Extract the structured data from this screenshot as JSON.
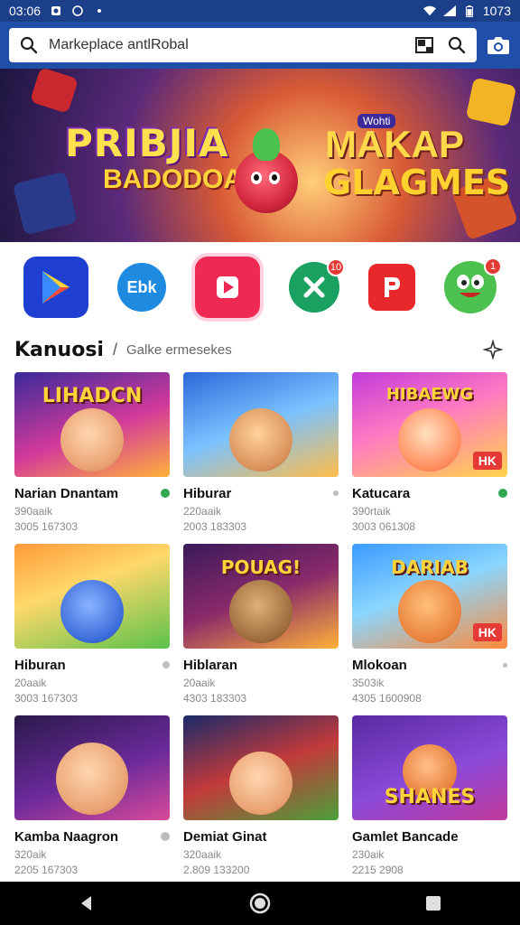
{
  "status_bar": {
    "time": "03:06",
    "battery_text": "1073"
  },
  "search": {
    "query": "Markeplace antlRobal"
  },
  "hero": {
    "title_left": "PRIBJIA",
    "sub_left": "BADODOA!",
    "badge_text": "Wohti",
    "title_right_top": "MAKAP",
    "title_right_bottom": "GLAGMES"
  },
  "apps": [
    {
      "name": "play-store",
      "label": ""
    },
    {
      "name": "ebk",
      "label": "Ebk"
    },
    {
      "name": "video-red",
      "label": ""
    },
    {
      "name": "green-x",
      "label": "",
      "badge": "10"
    },
    {
      "name": "red-p",
      "label": ""
    },
    {
      "name": "green-face",
      "label": "",
      "badge": "1"
    }
  ],
  "section": {
    "title": "Kanuosi",
    "separator": "/",
    "subtitle": "Galke ermesekes"
  },
  "cards": [
    {
      "title": "Narian Dnantam",
      "meta1": "390aaik",
      "meta2": "3005 167303",
      "thumb_title": "LIHADCN",
      "tag": "",
      "dot": "#2fa84f"
    },
    {
      "title": "Hiburar",
      "meta1": "220aaik",
      "meta2": "2003 183303",
      "thumb_title": "",
      "tag": "",
      "dot": "#bdbdbd"
    },
    {
      "title": "Katucara",
      "meta1": "390rtaik",
      "meta2": "3003 061308",
      "thumb_title": "HIBAEWG",
      "tag": "HK",
      "dot": "#2fa84f"
    },
    {
      "title": "Hiburan",
      "meta1": "20aaik",
      "meta2": "3003 167303",
      "thumb_title": "",
      "tag": "",
      "dot": "#bdbdbd"
    },
    {
      "title": "Hiblaran",
      "meta1": "20aaik",
      "meta2": "4303 183303",
      "thumb_title": "POUAG!",
      "tag": "",
      "dot": ""
    },
    {
      "title": "Mlokoan",
      "meta1": "3503ik",
      "meta2": "4305 1600908",
      "thumb_title": "DARIAB",
      "tag": "HK",
      "dot": "#bdbdbd"
    },
    {
      "title": "Kamba Naagron",
      "meta1": "320aik",
      "meta2": "2205 167303",
      "thumb_title": "",
      "tag": "",
      "dot": "#bdbdbd"
    },
    {
      "title": "Demiat Ginat",
      "meta1": "320aaik",
      "meta2": "2.809 133200",
      "thumb_title": "",
      "tag": "",
      "dot": ""
    },
    {
      "title": "Gamlet Bancade",
      "meta1": "230aik",
      "meta2": "2215 2908",
      "thumb_title": "SHANES",
      "tag": "",
      "dot": ""
    }
  ],
  "colors": {
    "appbar": "#1f4fa6",
    "statusbar": "#1b3f88"
  }
}
